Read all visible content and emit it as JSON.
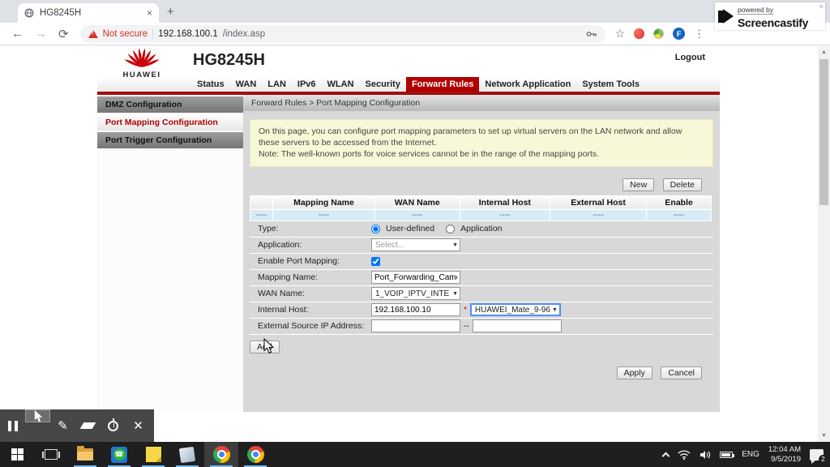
{
  "browser": {
    "tab_title": "HG8245H",
    "close_tab": "×",
    "new_tab": "+",
    "back": "←",
    "forward": "→",
    "reload": "⟳",
    "security_label": "Not secure",
    "url_host": "192.168.100.1",
    "url_path": "/index.asp",
    "extension_f_label": "F",
    "menu_dots": "⋮",
    "screencastify": {
      "powered": "powered by",
      "name": "Screencastify",
      "close": "×"
    }
  },
  "router": {
    "brand": "HUAWEI",
    "model": "HG8245H",
    "logout": "Logout",
    "nav": [
      "Status",
      "WAN",
      "LAN",
      "IPv6",
      "WLAN",
      "Security",
      "Forward Rules",
      "Network Application",
      "System Tools"
    ],
    "sidebar": [
      "DMZ Configuration",
      "Port Mapping Configuration",
      "Port Trigger Configuration"
    ],
    "breadcrumb": "Forward Rules > Port Mapping Configuration",
    "note_line1": "On this page, you can configure port mapping parameters to set up virtual servers on the LAN network and allow these servers to be accessed from the Internet.",
    "note_line2": "Note: The well-known ports for voice services cannot be in the range of the mapping ports.",
    "buttons": {
      "new": "New",
      "delete": "Delete",
      "add": "Add",
      "apply": "Apply",
      "cancel": "Cancel"
    },
    "table": {
      "headers": [
        "",
        "Mapping Name",
        "WAN Name",
        "Internal Host",
        "External Host",
        "Enable"
      ],
      "row": [
        "----",
        "----",
        "----",
        "----",
        "----",
        "----"
      ]
    },
    "form": {
      "type_label": "Type:",
      "type_user_defined": "User-defined",
      "type_application": "Application",
      "application_label": "Application:",
      "application_value": "Select...",
      "enable_label": "Enable Port Mapping:",
      "mapping_name_label": "Mapping Name:",
      "mapping_name_value": "Port_Forwarding_Camer",
      "wan_label": "WAN Name:",
      "wan_value": "1_VOIP_IPTV_INTE",
      "internal_host_label": "Internal Host:",
      "internal_host_value": "192.168.100.10",
      "required_mark": "*",
      "internal_host_device": "HUAWEI_Mate_9-96",
      "external_ip_label": "External Source IP Address:",
      "range_separator": "--",
      "dropdown_caret": "▼"
    }
  },
  "taskbar": {
    "language": "ENG",
    "time": "12:04 AM",
    "date": "9/5/2019",
    "notification_count": "2"
  },
  "colors": {
    "huawei_red": "#c8000b",
    "nav_active_bg": "#b10000",
    "red_line": "#a30d0f",
    "note_bg": "#f8f8d8",
    "table_row_blue": "#d8ecf8",
    "focus_blue": "#4d90fe",
    "not_secure_red": "#d93025",
    "taskbar_bg": "#1f1f1f"
  }
}
